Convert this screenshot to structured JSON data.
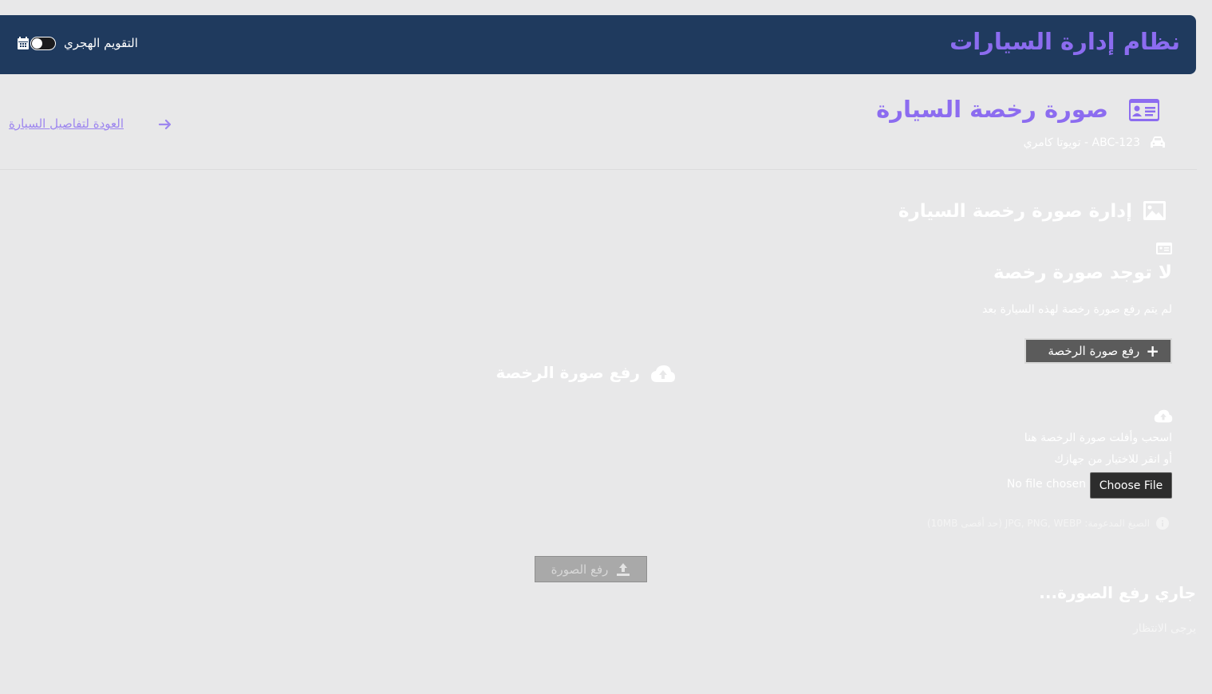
{
  "header": {
    "app_title": "نظام إدارة السيارات",
    "hijri_toggle_label": "التقويم الهجري",
    "hijri_toggle_state": "off"
  },
  "page": {
    "title": "صورة رخصة السيارة",
    "subtitle": "ABC-123 - تويوتا كامري",
    "back_link": "العودة لتفاصيل السيارة"
  },
  "management": {
    "section_title": "إدارة صورة رخصة السيارة",
    "empty_title": "لا توجد صورة رخصة",
    "empty_desc": "لم يتم رفع صورة رخصة لهذه السيارة بعد",
    "upload_button": "رفع صورة الرخصة"
  },
  "upload": {
    "title": "رفع صورة الرخصة",
    "drop_line1": "اسحب وأفلت صورة الرخصة هنا",
    "drop_line2": "أو انقر للاختيار من جهازك",
    "choose_file": "Choose File",
    "no_file": "No file chosen",
    "formats": "الصيغ المدعومة: JPG, PNG, WEBP (حد أقصى 10MB)",
    "submit_button": "رفع الصورة",
    "uploading_title": "جاري رفع الصورة...",
    "wait_text": "يرجى الانتظار"
  },
  "colors": {
    "header_bg": "#1f3a5e",
    "accent": "#8c6cf0",
    "page_bg": "#e8e8e9"
  },
  "icons": [
    "calendar-icon",
    "id-card-icon",
    "car-icon",
    "arrow-right-icon",
    "image-icon",
    "plus-icon",
    "cloud-upload-icon",
    "info-icon",
    "upload-icon"
  ]
}
